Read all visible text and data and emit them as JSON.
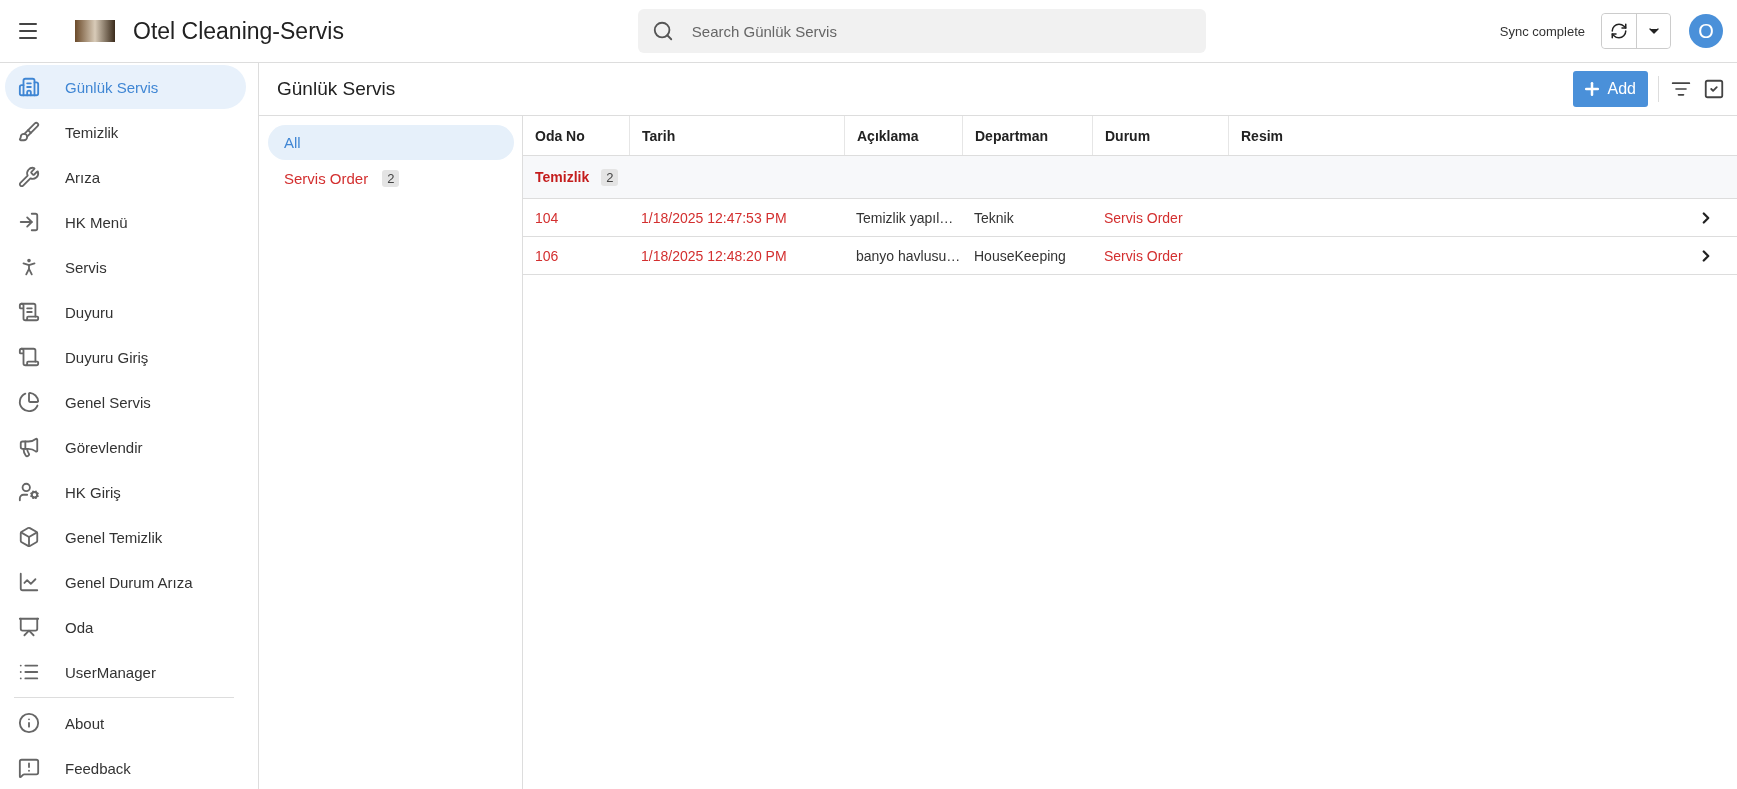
{
  "app": {
    "title": "Otel Cleaning-Servis"
  },
  "search": {
    "placeholder": "Search Günlük Servis"
  },
  "sync": {
    "status": "Sync complete"
  },
  "user": {
    "initial": "O"
  },
  "sidebar": {
    "items": [
      {
        "label": "Günlük Servis",
        "selected": true
      },
      {
        "label": "Temizlik",
        "selected": false
      },
      {
        "label": "Arıza",
        "selected": false
      },
      {
        "label": "HK Menü",
        "selected": false
      },
      {
        "label": "Servis",
        "selected": false
      },
      {
        "label": "Duyuru",
        "selected": false
      },
      {
        "label": "Duyuru Giriş",
        "selected": false
      },
      {
        "label": "Genel Servis",
        "selected": false
      },
      {
        "label": "Görevlendir",
        "selected": false
      },
      {
        "label": "HK Giriş",
        "selected": false
      },
      {
        "label": "Genel Temizlik",
        "selected": false
      },
      {
        "label": "Genel Durum Arıza",
        "selected": false
      },
      {
        "label": "Oda",
        "selected": false
      },
      {
        "label": "UserManager",
        "selected": false
      }
    ],
    "footer_items": [
      {
        "label": "About"
      },
      {
        "label": "Feedback"
      }
    ]
  },
  "page": {
    "title": "Günlük Servis",
    "add_button": "Add"
  },
  "filters": [
    {
      "label": "All",
      "selected": true
    },
    {
      "label": "Servis Order",
      "selected": false,
      "count": "2"
    }
  ],
  "table": {
    "columns": [
      "Oda No",
      "Tarih",
      "Açıklama",
      "Departman",
      "Durum",
      "Resim"
    ],
    "groups": [
      {
        "label": "Temizlik",
        "count": "2",
        "rows": [
          {
            "cells": [
              "104",
              "1/18/2025 12:47:53 PM",
              "Temizlik yapıl…",
              "Teknik",
              "Servis Order",
              ""
            ]
          },
          {
            "cells": [
              "106",
              "1/18/2025 12:48:20 PM",
              "banyo havlusu…",
              "HouseKeeping",
              "Servis Order",
              ""
            ]
          }
        ]
      }
    ]
  }
}
